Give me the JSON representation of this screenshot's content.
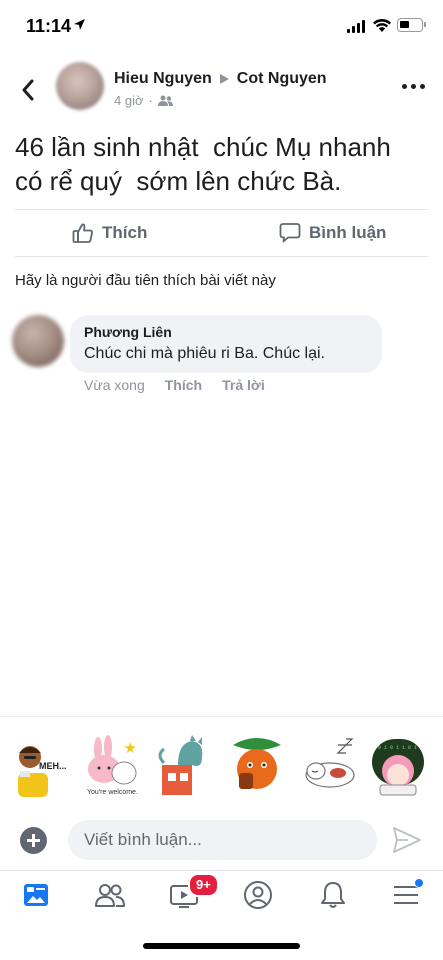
{
  "status_bar": {
    "time": "11:14"
  },
  "post": {
    "author": "Hieu Nguyen",
    "target": "Cot Nguyen",
    "time": "4 giờ",
    "separator": "·",
    "text": "46 lần sinh nhật  chúc Mụ nhanh có rể quý  sớm lên chức Bà.",
    "actions": {
      "like_label": "Thích",
      "comment_label": "Bình luận"
    },
    "likes_note": "Hãy là người đầu tiên thích bài viết này"
  },
  "comment": {
    "author": "Phương Liên",
    "text": "Chúc chi mà phiêu ri Ba. Chúc lại.",
    "time": "Vừa xong",
    "like_label": "Thích",
    "reply_label": "Trả lời"
  },
  "stickers": [
    {
      "name": "sticker-meh-man",
      "caption": "MEH..."
    },
    {
      "name": "sticker-bunny-welcome",
      "caption": "You're welcome."
    },
    {
      "name": "sticker-cat-on-house",
      "caption": ""
    },
    {
      "name": "sticker-orange-leaf",
      "caption": ""
    },
    {
      "name": "sticker-sleeping-dog",
      "caption": ""
    },
    {
      "name": "sticker-pink-hair-girl",
      "caption": ""
    }
  ],
  "composer": {
    "placeholder": "Viết bình luận..."
  },
  "tab_bar": {
    "video_badge": "9+"
  },
  "colors": {
    "accent": "#1877f2",
    "badge": "#e41e3f",
    "secondary_text": "#90949c",
    "bubble_bg": "#f0f2f5"
  }
}
